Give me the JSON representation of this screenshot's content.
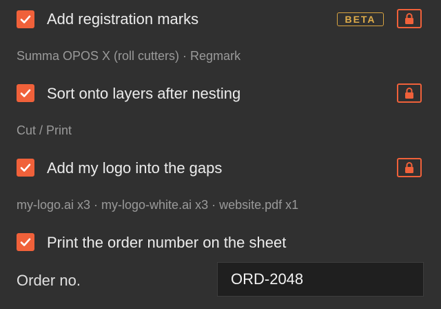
{
  "colors": {
    "accent": "#f0613a",
    "beta": "#e0ad4a",
    "background": "#303030"
  },
  "options": [
    {
      "label": "Add registration marks",
      "checked": true,
      "badge": "BETA",
      "locked": true,
      "detail": "Summa OPOS X (roll cutters) · Regmark"
    },
    {
      "label": "Sort onto layers after nesting",
      "checked": true,
      "locked": true,
      "detail": "Cut / Print"
    },
    {
      "label": "Add my logo into the gaps",
      "checked": true,
      "locked": true,
      "detail": "my-logo.ai x3 · my-logo-white.ai x3 · website.pdf x1"
    },
    {
      "label": "Print the order number on the sheet",
      "checked": true
    }
  ],
  "order": {
    "label": "Order no.",
    "value": "ORD-2048"
  },
  "icons": {
    "check": "check-icon",
    "lock": "lock-icon"
  }
}
